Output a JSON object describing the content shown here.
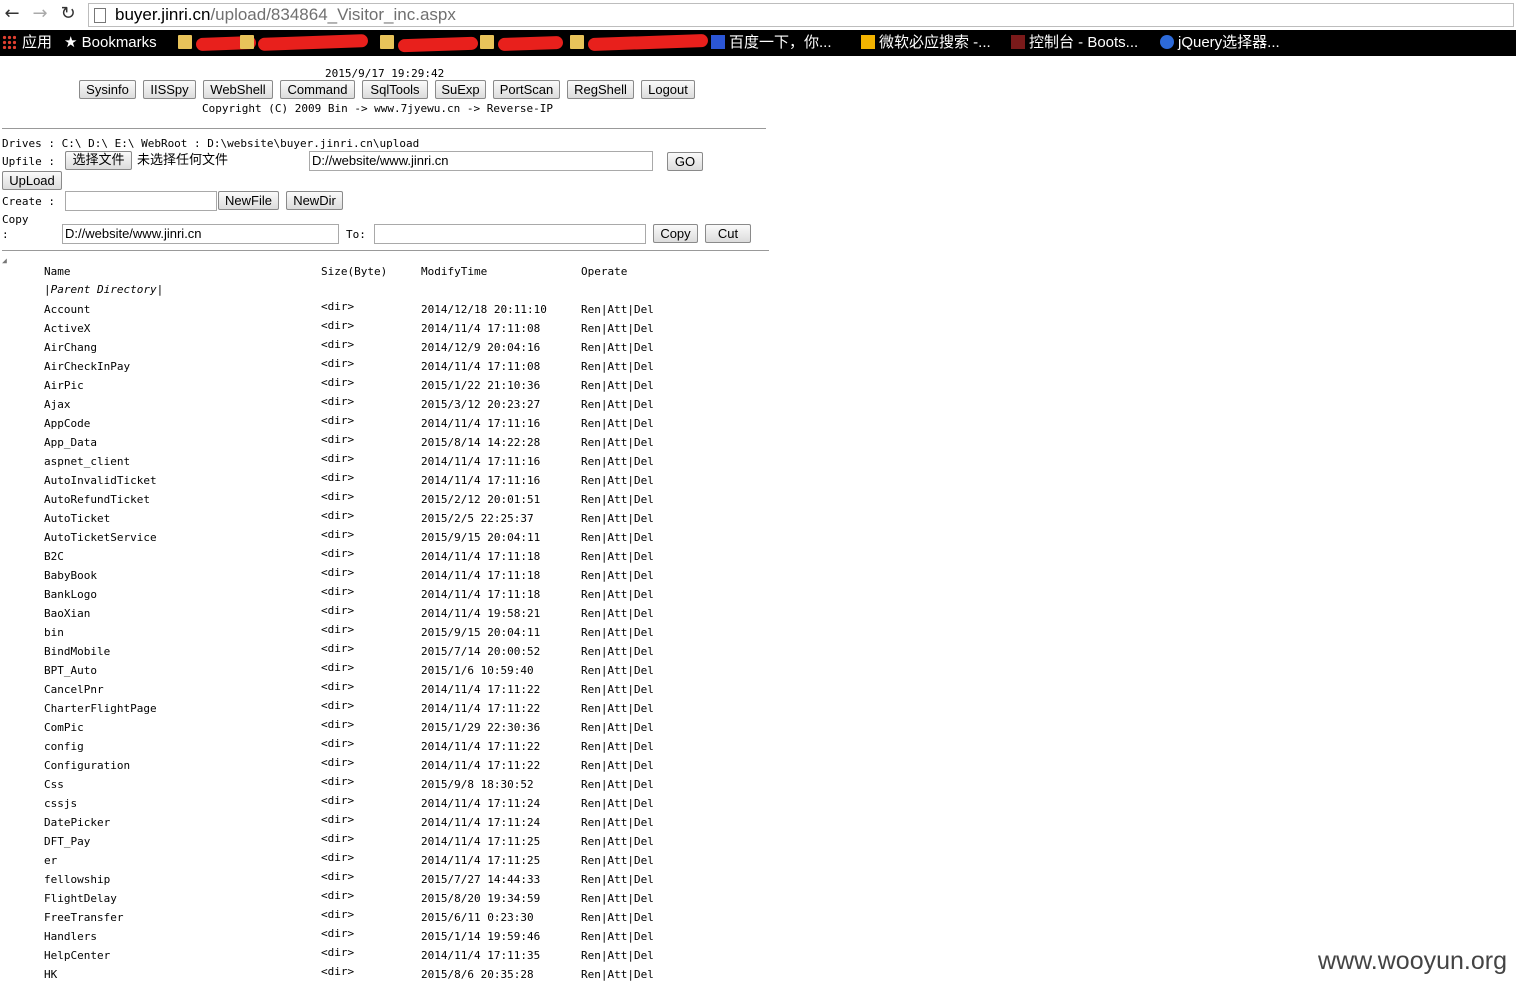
{
  "browser": {
    "url_host": "buyer.jinri.cn",
    "url_path": "/upload/834864_Visitor_inc.aspx",
    "bookmarks": [
      {
        "label": "应用"
      },
      {
        "label": "Bookmarks"
      },
      {
        "label": "百度一下，你..."
      },
      {
        "label": "微软必应搜索 -..."
      },
      {
        "label": "控制台 - Boots..."
      },
      {
        "label": "jQuery选择器..."
      }
    ]
  },
  "shell": {
    "datetime": "2015/9/17 19:29:42",
    "menu": [
      "Sysinfo",
      "IISSpy",
      "WebShell",
      "Command",
      "SqlTools",
      "SuExp",
      "PortScan",
      "RegShell",
      "Logout"
    ],
    "copyright": "Copyright (C) 2009 Bin -> www.7jyewu.cn -> Reverse-IP",
    "drives_line": "Drives : C:\\ D:\\ E:\\  WebRoot : D:\\website\\buyer.jinri.cn\\upload",
    "upfile_label": "Upfile :",
    "choose_file": "选择文件",
    "no_file": "未选择任何文件",
    "path_value": "D://website/www.jinri.cn",
    "go": "GO",
    "upload": "UpLoad",
    "create_label": "Create :",
    "newfile": "NewFile",
    "newdir": "NewDir",
    "copy_label_1": "Copy",
    "copy_label_2": ":",
    "copy_from": "D://website/www.jinri.cn",
    "to_label": "To:",
    "copy_btn": "Copy",
    "cut_btn": "Cut"
  },
  "table": {
    "headers": {
      "name": "Name",
      "size": "Size(Byte)",
      "time": "ModifyTime",
      "op": "Operate"
    },
    "parent": "|Parent Directory|",
    "ops": [
      "Ren",
      "Att",
      "Del"
    ],
    "rows": [
      {
        "name": "Account",
        "size": "<dir>",
        "time": "2014/12/18 20:11:10"
      },
      {
        "name": "ActiveX",
        "size": "<dir>",
        "time": "2014/11/4 17:11:08"
      },
      {
        "name": "AirChang",
        "size": "<dir>",
        "time": "2014/12/9 20:04:16"
      },
      {
        "name": "AirCheckInPay",
        "size": "<dir>",
        "time": "2014/11/4 17:11:08"
      },
      {
        "name": "AirPic",
        "size": "<dir>",
        "time": "2015/1/22 21:10:36"
      },
      {
        "name": "Ajax",
        "size": "<dir>",
        "time": "2015/3/12 20:23:27"
      },
      {
        "name": "AppCode",
        "size": "<dir>",
        "time": "2014/11/4 17:11:16"
      },
      {
        "name": "App_Data",
        "size": "<dir>",
        "time": "2015/8/14 14:22:28"
      },
      {
        "name": "aspnet_client",
        "size": "<dir>",
        "time": "2014/11/4 17:11:16"
      },
      {
        "name": "AutoInvalidTicket",
        "size": "<dir>",
        "time": "2014/11/4 17:11:16"
      },
      {
        "name": "AutoRefundTicket",
        "size": "<dir>",
        "time": "2015/2/12 20:01:51"
      },
      {
        "name": "AutoTicket",
        "size": "<dir>",
        "time": "2015/2/5 22:25:37"
      },
      {
        "name": "AutoTicketService",
        "size": "<dir>",
        "time": "2015/9/15 20:04:11"
      },
      {
        "name": "B2C",
        "size": "<dir>",
        "time": "2014/11/4 17:11:18"
      },
      {
        "name": "BabyBook",
        "size": "<dir>",
        "time": "2014/11/4 17:11:18"
      },
      {
        "name": "BankLogo",
        "size": "<dir>",
        "time": "2014/11/4 17:11:18"
      },
      {
        "name": "BaoXian",
        "size": "<dir>",
        "time": "2014/11/4 19:58:21"
      },
      {
        "name": "bin",
        "size": "<dir>",
        "time": "2015/9/15 20:04:11"
      },
      {
        "name": "BindMobile",
        "size": "<dir>",
        "time": "2015/7/14 20:00:52"
      },
      {
        "name": "BPT_Auto",
        "size": "<dir>",
        "time": "2015/1/6 10:59:40"
      },
      {
        "name": "CancelPnr",
        "size": "<dir>",
        "time": "2014/11/4 17:11:22"
      },
      {
        "name": "CharterFlightPage",
        "size": "<dir>",
        "time": "2014/11/4 17:11:22"
      },
      {
        "name": "ComPic",
        "size": "<dir>",
        "time": "2015/1/29 22:30:36"
      },
      {
        "name": "config",
        "size": "<dir>",
        "time": "2014/11/4 17:11:22"
      },
      {
        "name": "Configuration",
        "size": "<dir>",
        "time": "2014/11/4 17:11:22"
      },
      {
        "name": "Css",
        "size": "<dir>",
        "time": "2015/9/8 18:30:52"
      },
      {
        "name": "cssjs",
        "size": "<dir>",
        "time": "2014/11/4 17:11:24"
      },
      {
        "name": "DatePicker",
        "size": "<dir>",
        "time": "2014/11/4 17:11:24"
      },
      {
        "name": "DFT_Pay",
        "size": "<dir>",
        "time": "2014/11/4 17:11:25"
      },
      {
        "name": "er",
        "size": "<dir>",
        "time": "2014/11/4 17:11:25"
      },
      {
        "name": "fellowship",
        "size": "<dir>",
        "time": "2015/7/27 14:44:33"
      },
      {
        "name": "FlightDelay",
        "size": "<dir>",
        "time": "2015/8/20 19:34:59"
      },
      {
        "name": "FreeTransfer",
        "size": "<dir>",
        "time": "2015/6/11 0:23:30"
      },
      {
        "name": "Handlers",
        "size": "<dir>",
        "time": "2015/1/14 19:59:46"
      },
      {
        "name": "HelpCenter",
        "size": "<dir>",
        "time": "2014/11/4 17:11:35"
      },
      {
        "name": "HK",
        "size": "<dir>",
        "time": "2015/8/6 20:35:28"
      }
    ]
  },
  "watermark": "www.wooyun.org"
}
